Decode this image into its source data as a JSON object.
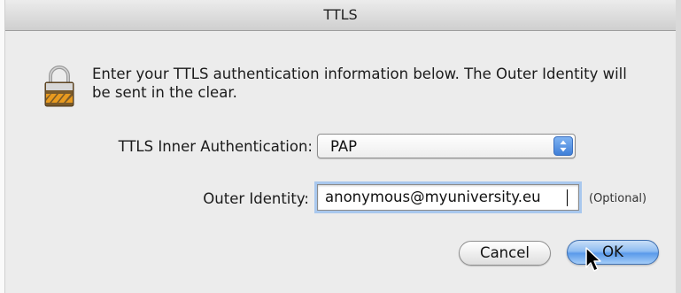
{
  "window": {
    "title": "TTLS"
  },
  "message": {
    "text": "Enter your TTLS authentication information below. The Outer Identity will be sent in the clear."
  },
  "inner_auth": {
    "label": "TTLS Inner Authentication:",
    "selected": "PAP"
  },
  "outer_identity": {
    "label": "Outer Identity:",
    "value": "anonymous@myuniversity.eu",
    "hint": "(Optional)"
  },
  "buttons": {
    "cancel_label": "Cancel",
    "ok_label": "OK"
  },
  "icons": {
    "lock": "lock-icon",
    "popup_arrows": "up-down-arrows-icon",
    "cursor": "mouse-pointer-icon"
  },
  "colors": {
    "default_button": "#5a9aea",
    "focus_ring": "#a9c8ee"
  }
}
